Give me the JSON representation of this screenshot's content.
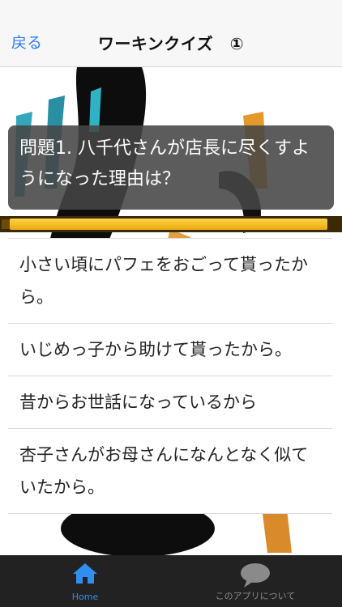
{
  "nav": {
    "back_label": "戻る",
    "title": "ワーキンクイズ　①"
  },
  "question": {
    "text": "問題1. 八千代さんが店長に尽くすようになった理由は？"
  },
  "progress": {
    "value": 0.97
  },
  "answers": [
    "小さい頃にパフェをおごって貰ったから。",
    "いじめっ子から助けて貰ったから。",
    "昔からお世話になっているから",
    "杏子さんがお母さんになんとなく似ていたから。"
  ],
  "tabs": [
    {
      "label": "Home",
      "icon": "home-icon",
      "active": true
    },
    {
      "label": "このアプリについて",
      "icon": "speech-bubble-icon",
      "active": false
    }
  ],
  "colors": {
    "accent": "#2f8ef2",
    "tabbar": "#222222",
    "progress": "#f5b51a"
  }
}
